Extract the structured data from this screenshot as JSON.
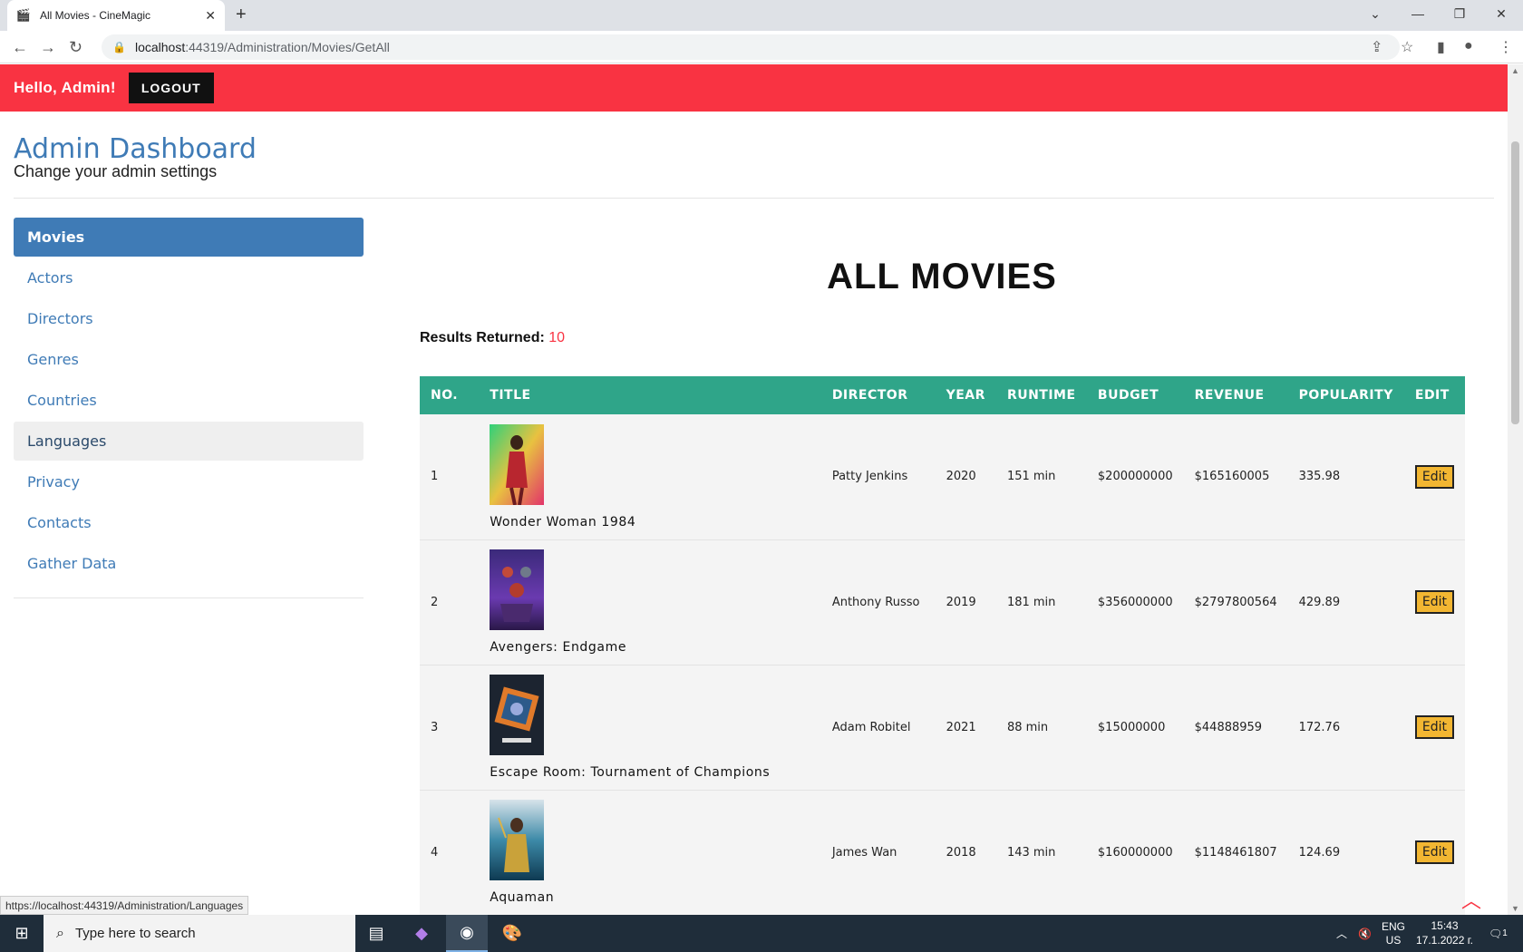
{
  "browser": {
    "tab_title": "All Movies - CineMagic",
    "url_host": "localhost",
    "url_path": ":44319/Administration/Movies/GetAll",
    "status_url": "https://localhost:44319/Administration/Languages"
  },
  "topbar": {
    "greeting": "Hello, Admin!",
    "logout_label": "LOGOUT"
  },
  "dashboard": {
    "title": "Admin Dashboard",
    "subtitle": "Change your admin settings"
  },
  "sidebar": {
    "items": [
      {
        "label": "Movies"
      },
      {
        "label": "Actors"
      },
      {
        "label": "Directors"
      },
      {
        "label": "Genres"
      },
      {
        "label": "Countries"
      },
      {
        "label": "Languages"
      },
      {
        "label": "Privacy"
      },
      {
        "label": "Contacts"
      },
      {
        "label": "Gather Data"
      }
    ]
  },
  "main": {
    "title": "ALL MOVIES",
    "results_label": "Results Returned:",
    "results_count": "10"
  },
  "table": {
    "headers": [
      "NO.",
      "TITLE",
      "DIRECTOR",
      "YEAR",
      "RUNTIME",
      "BUDGET",
      "REVENUE",
      "POPULARITY",
      "EDIT"
    ],
    "edit_label": "Edit",
    "rows": [
      {
        "no": "1",
        "title": "Wonder Woman 1984",
        "director": "Patty Jenkins",
        "year": "2020",
        "runtime": "151 min",
        "budget": "$200000000",
        "revenue": "$165160005",
        "popularity": "335.98"
      },
      {
        "no": "2",
        "title": "Avengers: Endgame",
        "director": "Anthony Russo",
        "year": "2019",
        "runtime": "181 min",
        "budget": "$356000000",
        "revenue": "$2797800564",
        "popularity": "429.89"
      },
      {
        "no": "3",
        "title": "Escape Room: Tournament of Champions",
        "director": "Adam Robitel",
        "year": "2021",
        "runtime": "88 min",
        "budget": "$15000000",
        "revenue": "$44888959",
        "popularity": "172.76"
      },
      {
        "no": "4",
        "title": "Aquaman",
        "director": "James Wan",
        "year": "2018",
        "runtime": "143 min",
        "budget": "$160000000",
        "revenue": "$1148461807",
        "popularity": "124.69"
      }
    ]
  },
  "taskbar": {
    "search_placeholder": "Type here to search",
    "lang_top": "ENG",
    "lang_bottom": "US",
    "time": "15:43",
    "date": "17.1.2022 г.",
    "notifications": "1"
  },
  "colors": {
    "accent_red": "#f93342",
    "accent_blue": "#3f7bb6",
    "table_header": "#2fa589",
    "edit_button": "#f2b632"
  }
}
